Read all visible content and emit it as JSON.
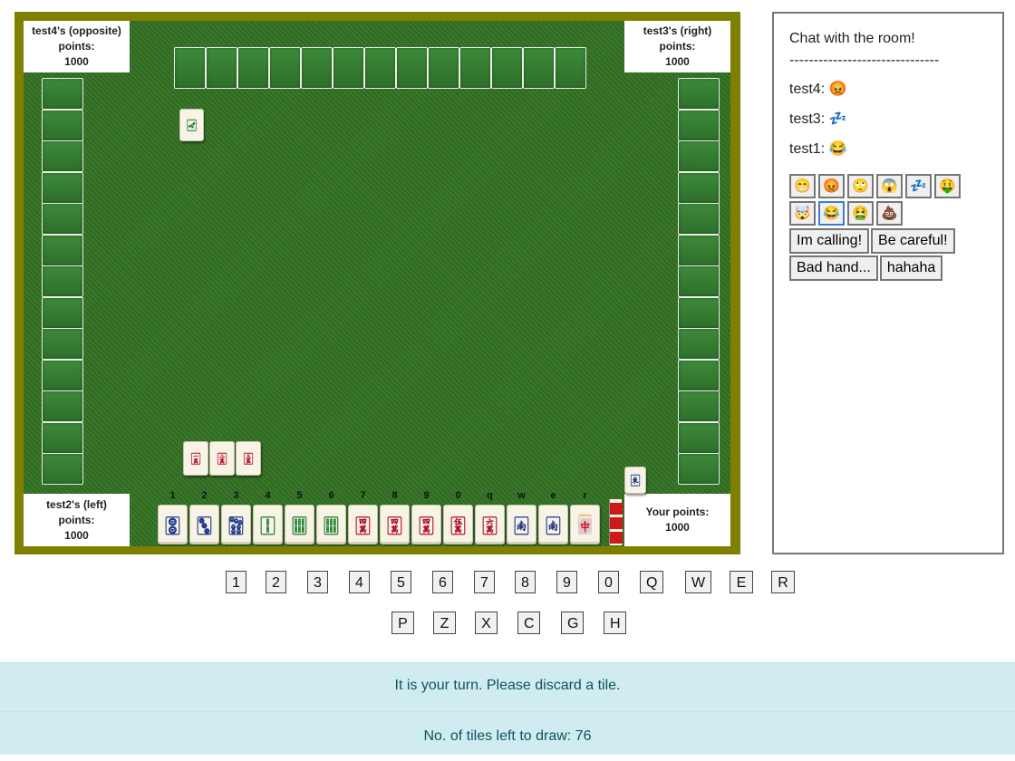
{
  "players": {
    "opposite": {
      "label": "test4's (opposite)",
      "points_label": "points:",
      "points": "1000"
    },
    "right": {
      "label": "test3's (right)",
      "points_label": "points:",
      "points": "1000"
    },
    "left": {
      "label": "test2's (left)",
      "points_label": "points:",
      "points": "1000"
    },
    "self": {
      "label": "Your points:",
      "points": "1000"
    }
  },
  "board": {
    "background_color": "#2e6f1e",
    "frame_color": "#808000",
    "opposite_hand_count": 13,
    "left_hand_count": 13,
    "right_hand_count": 13,
    "discards": {
      "opposite": [
        "🀐"
      ],
      "self_melds": [
        "🀇",
        "🀈",
        "🀉"
      ],
      "right": [
        "🀀"
      ]
    }
  },
  "hand": {
    "key_hints": [
      "1",
      "2",
      "3",
      "4",
      "5",
      "6",
      "7",
      "8",
      "9",
      "0",
      "q",
      "w",
      "e",
      "r"
    ],
    "tiles": [
      {
        "glyph": "🀚",
        "name": "two-circles-tile"
      },
      {
        "glyph": "🀛",
        "name": "three-circles-tile"
      },
      {
        "glyph": "🀟",
        "name": "seven-circles-tile"
      },
      {
        "glyph": "🀑",
        "name": "two-bamboo-tile"
      },
      {
        "glyph": "🀕",
        "name": "six-bamboo-tile"
      },
      {
        "glyph": "🀕",
        "name": "six-bamboo-tile-2"
      },
      {
        "glyph": "🀊",
        "name": "four-characters-tile"
      },
      {
        "glyph": "🀊",
        "name": "four-characters-tile-2"
      },
      {
        "glyph": "🀊",
        "name": "four-characters-tile-3"
      },
      {
        "glyph": "🀋",
        "name": "five-characters-tile"
      },
      {
        "glyph": "🀌",
        "name": "six-characters-tile"
      },
      {
        "glyph": "🀁",
        "name": "south-wind-tile"
      },
      {
        "glyph": "🀁",
        "name": "south-wind-tile-2"
      },
      {
        "glyph": "🀄",
        "name": "red-dragon-tile"
      }
    ]
  },
  "chat": {
    "title": "Chat with the room!",
    "divider": "-------------------------------",
    "messages": [
      {
        "user": "test4:",
        "emoji": "😡"
      },
      {
        "user": "test3:",
        "emoji": "💤"
      },
      {
        "user": "test1:",
        "emoji": "😂"
      }
    ],
    "emojis": [
      "😁",
      "😡",
      "🙄",
      "😱",
      "💤",
      "🤑",
      "🤯",
      "😂",
      "🤮",
      "💩"
    ],
    "active_emoji_index": 7,
    "phrases": [
      "Im calling!",
      "Be careful!",
      "Bad hand...",
      "hahaha"
    ]
  },
  "keys": {
    "row1": [
      "1",
      "2",
      "3",
      "4",
      "5",
      "6",
      "7",
      "8",
      "9",
      "0",
      "Q",
      "W",
      "E",
      "R"
    ],
    "row2": [
      "P",
      "Z",
      "X",
      "C",
      "G",
      "H"
    ]
  },
  "status": {
    "turn_message": "It is your turn. Please discard a tile.",
    "tiles_left": "No. of tiles left to draw: 76"
  }
}
